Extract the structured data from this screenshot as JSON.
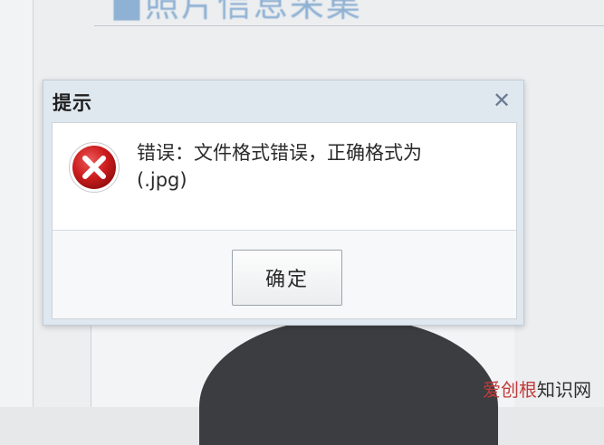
{
  "background": {
    "page_title": "■照片信息采集",
    "watermark": {
      "brand": "爱创根",
      "suffix": "知识网"
    }
  },
  "dialog": {
    "title": "提示",
    "close_glyph": "✕",
    "message_line1": "错误：文件格式错误，正确格式为",
    "message_line2": "(.jpg)",
    "ok_label": "确定",
    "icon": "error-circle-x-icon"
  },
  "colors": {
    "dialog_frame": "#dfe7ef",
    "error_red": "#cc1d1d",
    "close_icon": "#6a7c92"
  }
}
